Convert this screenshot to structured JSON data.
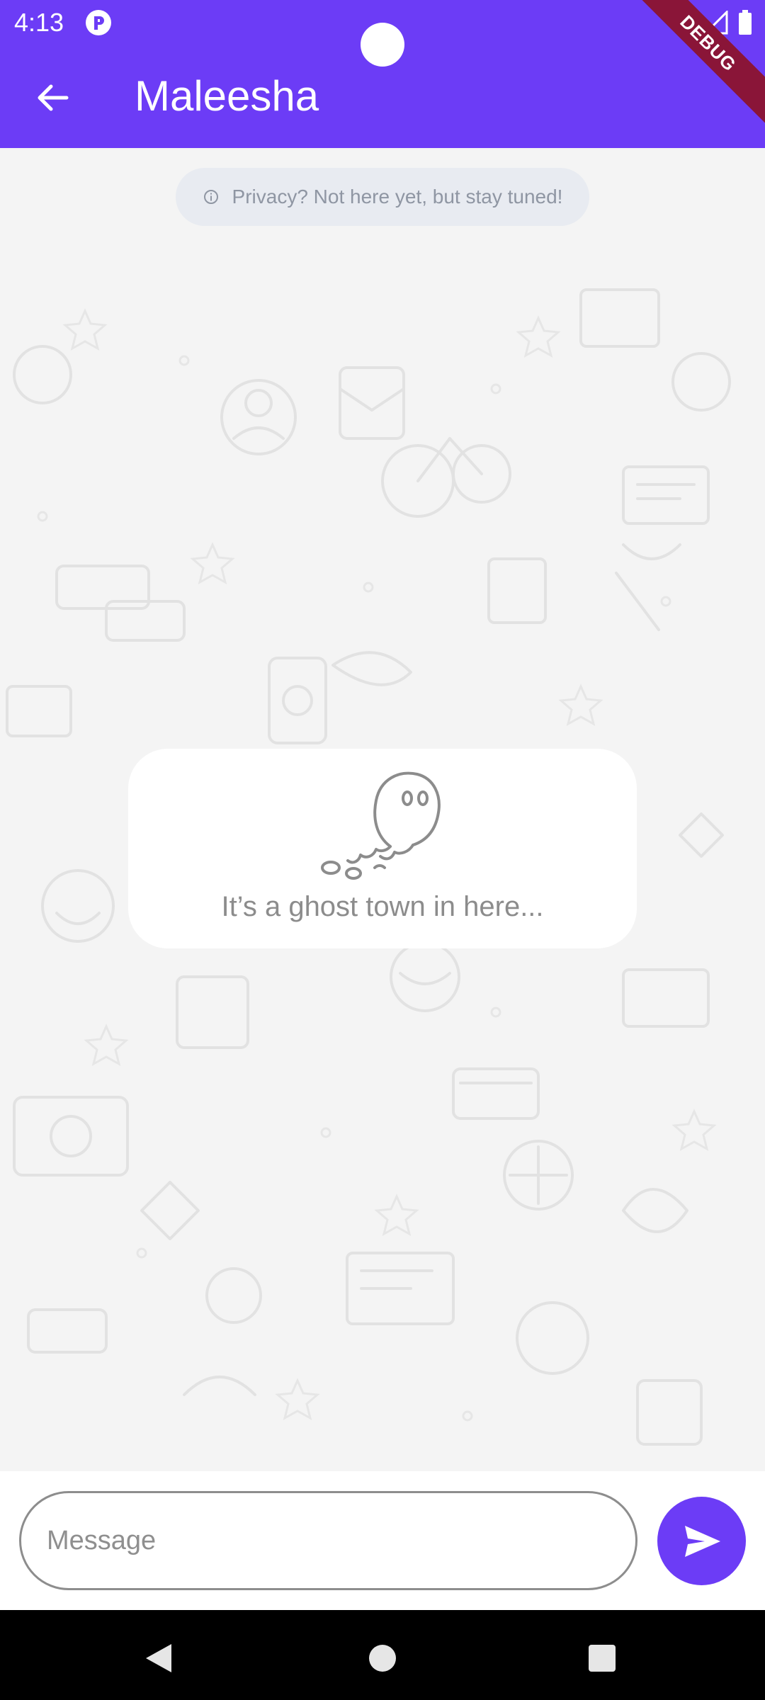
{
  "status_bar": {
    "time": "4:13",
    "debug_label": "DEBUG"
  },
  "app_bar": {
    "title": "Maleesha",
    "back_icon": "arrow-left-icon"
  },
  "chat": {
    "privacy_notice": "Privacy? Not here yet, but stay tuned!",
    "empty_state_text": "It’s a ghost town in here...",
    "empty_state_icon": "ghost-icon"
  },
  "composer": {
    "placeholder": "Message",
    "value": "",
    "send_icon": "send-icon"
  },
  "nav_bar": {
    "back_icon": "triangle-back-icon",
    "home_icon": "circle-home-icon",
    "recents_icon": "square-recents-icon"
  },
  "colors": {
    "primary": "#6c3cf6",
    "debug_banner": "#8a1538",
    "chat_background": "#f4f4f4",
    "privacy_chip": "#e8ebf1"
  }
}
